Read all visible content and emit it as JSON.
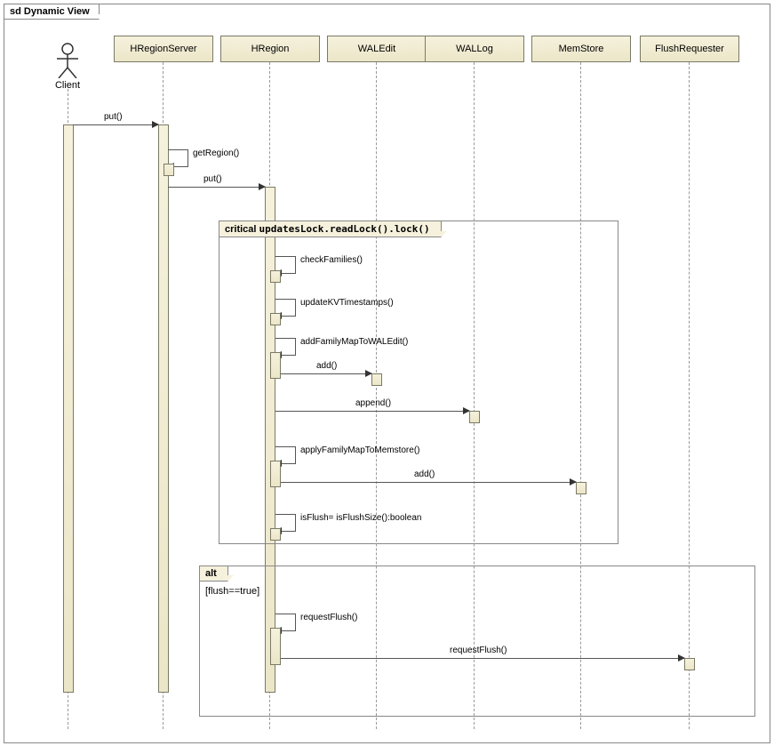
{
  "frame_title": "sd Dynamic View",
  "lifelines": {
    "client": "Client",
    "regionserver": "HRegionServer",
    "hregion": "HRegion",
    "waledit": "WALEdit",
    "wallog": "WALLog",
    "memstore": "MemStore",
    "flushreq": "FlushRequester"
  },
  "messages": {
    "put1": "put()",
    "getRegion": "getRegion()",
    "put2": "put()",
    "checkFamilies": "checkFamilies()",
    "updateKV": "updateKVTimestamps()",
    "addFamWAL": "addFamilyMapToWALEdit()",
    "add1": "add()",
    "append": "append()",
    "applyFamMem": "applyFamilyMapToMemstore()",
    "add2": "add()",
    "isFlush": "isFlush= isFlushSize():boolean",
    "requestFlush1": "requestFlush()",
    "requestFlush2": "requestFlush()"
  },
  "fragments": {
    "critical_label": "critical",
    "critical_text": "updatesLock.readLock().lock()",
    "alt_label": "alt",
    "alt_guard": "[flush==true]"
  },
  "chart_data": {
    "type": "sequence_diagram",
    "title": "sd Dynamic View",
    "participants": [
      "Client",
      "HRegionServer",
      "HRegion",
      "WALEdit",
      "WALLog",
      "MemStore",
      "FlushRequester"
    ],
    "actor": "Client",
    "interactions": [
      {
        "from": "Client",
        "to": "HRegionServer",
        "label": "put()",
        "type": "sync"
      },
      {
        "from": "HRegionServer",
        "to": "HRegionServer",
        "label": "getRegion()",
        "type": "self"
      },
      {
        "from": "HRegionServer",
        "to": "HRegion",
        "label": "put()",
        "type": "sync"
      },
      {
        "fragment": "critical",
        "text": "updatesLock.readLock().lock()",
        "contains": [
          {
            "from": "HRegion",
            "to": "HRegion",
            "label": "checkFamilies()",
            "type": "self"
          },
          {
            "from": "HRegion",
            "to": "HRegion",
            "label": "updateKVTimestamps()",
            "type": "self"
          },
          {
            "from": "HRegion",
            "to": "HRegion",
            "label": "addFamilyMapToWALEdit()",
            "type": "self"
          },
          {
            "from": "HRegion",
            "to": "WALEdit",
            "label": "add()",
            "type": "sync"
          },
          {
            "from": "HRegion",
            "to": "WALLog",
            "label": "append()",
            "type": "sync"
          },
          {
            "from": "HRegion",
            "to": "HRegion",
            "label": "applyFamilyMapToMemstore()",
            "type": "self"
          },
          {
            "from": "HRegion",
            "to": "MemStore",
            "label": "add()",
            "type": "sync"
          },
          {
            "from": "HRegion",
            "to": "HRegion",
            "label": "isFlush= isFlushSize():boolean",
            "type": "self"
          }
        ]
      },
      {
        "fragment": "alt",
        "guard": "[flush==true]",
        "contains": [
          {
            "from": "HRegion",
            "to": "HRegion",
            "label": "requestFlush()",
            "type": "self"
          },
          {
            "from": "HRegion",
            "to": "FlushRequester",
            "label": "requestFlush()",
            "type": "sync"
          }
        ]
      }
    ]
  }
}
